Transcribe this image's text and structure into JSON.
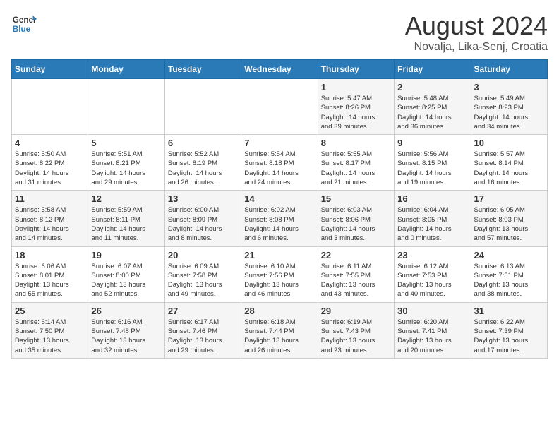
{
  "header": {
    "logo_general": "General",
    "logo_blue": "Blue",
    "title": "August 2024",
    "subtitle": "Novalja, Lika-Senj, Croatia"
  },
  "weekdays": [
    "Sunday",
    "Monday",
    "Tuesday",
    "Wednesday",
    "Thursday",
    "Friday",
    "Saturday"
  ],
  "weeks": [
    [
      {
        "day": "",
        "info": ""
      },
      {
        "day": "",
        "info": ""
      },
      {
        "day": "",
        "info": ""
      },
      {
        "day": "",
        "info": ""
      },
      {
        "day": "1",
        "info": "Sunrise: 5:47 AM\nSunset: 8:26 PM\nDaylight: 14 hours\nand 39 minutes."
      },
      {
        "day": "2",
        "info": "Sunrise: 5:48 AM\nSunset: 8:25 PM\nDaylight: 14 hours\nand 36 minutes."
      },
      {
        "day": "3",
        "info": "Sunrise: 5:49 AM\nSunset: 8:23 PM\nDaylight: 14 hours\nand 34 minutes."
      }
    ],
    [
      {
        "day": "4",
        "info": "Sunrise: 5:50 AM\nSunset: 8:22 PM\nDaylight: 14 hours\nand 31 minutes."
      },
      {
        "day": "5",
        "info": "Sunrise: 5:51 AM\nSunset: 8:21 PM\nDaylight: 14 hours\nand 29 minutes."
      },
      {
        "day": "6",
        "info": "Sunrise: 5:52 AM\nSunset: 8:19 PM\nDaylight: 14 hours\nand 26 minutes."
      },
      {
        "day": "7",
        "info": "Sunrise: 5:54 AM\nSunset: 8:18 PM\nDaylight: 14 hours\nand 24 minutes."
      },
      {
        "day": "8",
        "info": "Sunrise: 5:55 AM\nSunset: 8:17 PM\nDaylight: 14 hours\nand 21 minutes."
      },
      {
        "day": "9",
        "info": "Sunrise: 5:56 AM\nSunset: 8:15 PM\nDaylight: 14 hours\nand 19 minutes."
      },
      {
        "day": "10",
        "info": "Sunrise: 5:57 AM\nSunset: 8:14 PM\nDaylight: 14 hours\nand 16 minutes."
      }
    ],
    [
      {
        "day": "11",
        "info": "Sunrise: 5:58 AM\nSunset: 8:12 PM\nDaylight: 14 hours\nand 14 minutes."
      },
      {
        "day": "12",
        "info": "Sunrise: 5:59 AM\nSunset: 8:11 PM\nDaylight: 14 hours\nand 11 minutes."
      },
      {
        "day": "13",
        "info": "Sunrise: 6:00 AM\nSunset: 8:09 PM\nDaylight: 14 hours\nand 8 minutes."
      },
      {
        "day": "14",
        "info": "Sunrise: 6:02 AM\nSunset: 8:08 PM\nDaylight: 14 hours\nand 6 minutes."
      },
      {
        "day": "15",
        "info": "Sunrise: 6:03 AM\nSunset: 8:06 PM\nDaylight: 14 hours\nand 3 minutes."
      },
      {
        "day": "16",
        "info": "Sunrise: 6:04 AM\nSunset: 8:05 PM\nDaylight: 14 hours\nand 0 minutes."
      },
      {
        "day": "17",
        "info": "Sunrise: 6:05 AM\nSunset: 8:03 PM\nDaylight: 13 hours\nand 57 minutes."
      }
    ],
    [
      {
        "day": "18",
        "info": "Sunrise: 6:06 AM\nSunset: 8:01 PM\nDaylight: 13 hours\nand 55 minutes."
      },
      {
        "day": "19",
        "info": "Sunrise: 6:07 AM\nSunset: 8:00 PM\nDaylight: 13 hours\nand 52 minutes."
      },
      {
        "day": "20",
        "info": "Sunrise: 6:09 AM\nSunset: 7:58 PM\nDaylight: 13 hours\nand 49 minutes."
      },
      {
        "day": "21",
        "info": "Sunrise: 6:10 AM\nSunset: 7:56 PM\nDaylight: 13 hours\nand 46 minutes."
      },
      {
        "day": "22",
        "info": "Sunrise: 6:11 AM\nSunset: 7:55 PM\nDaylight: 13 hours\nand 43 minutes."
      },
      {
        "day": "23",
        "info": "Sunrise: 6:12 AM\nSunset: 7:53 PM\nDaylight: 13 hours\nand 40 minutes."
      },
      {
        "day": "24",
        "info": "Sunrise: 6:13 AM\nSunset: 7:51 PM\nDaylight: 13 hours\nand 38 minutes."
      }
    ],
    [
      {
        "day": "25",
        "info": "Sunrise: 6:14 AM\nSunset: 7:50 PM\nDaylight: 13 hours\nand 35 minutes."
      },
      {
        "day": "26",
        "info": "Sunrise: 6:16 AM\nSunset: 7:48 PM\nDaylight: 13 hours\nand 32 minutes."
      },
      {
        "day": "27",
        "info": "Sunrise: 6:17 AM\nSunset: 7:46 PM\nDaylight: 13 hours\nand 29 minutes."
      },
      {
        "day": "28",
        "info": "Sunrise: 6:18 AM\nSunset: 7:44 PM\nDaylight: 13 hours\nand 26 minutes."
      },
      {
        "day": "29",
        "info": "Sunrise: 6:19 AM\nSunset: 7:43 PM\nDaylight: 13 hours\nand 23 minutes."
      },
      {
        "day": "30",
        "info": "Sunrise: 6:20 AM\nSunset: 7:41 PM\nDaylight: 13 hours\nand 20 minutes."
      },
      {
        "day": "31",
        "info": "Sunrise: 6:22 AM\nSunset: 7:39 PM\nDaylight: 13 hours\nand 17 minutes."
      }
    ]
  ]
}
